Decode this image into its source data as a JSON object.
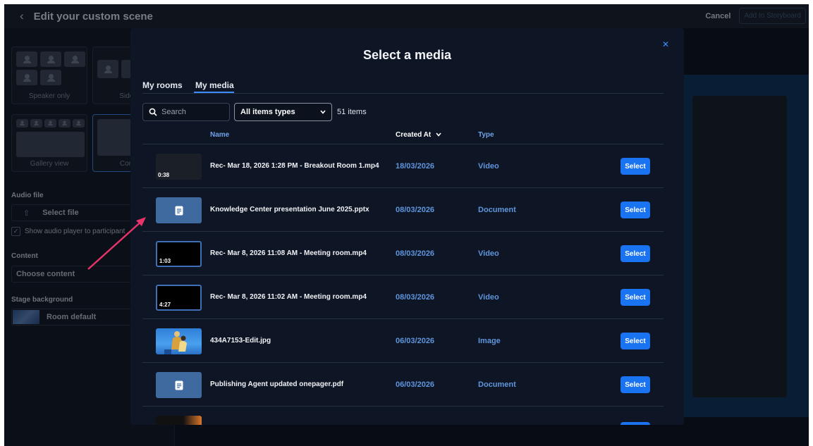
{
  "app": {
    "title": "Edit your custom scene",
    "cancel_label": "Cancel",
    "storyboard_label": "Add to Storyboard"
  },
  "left_panel": {
    "layouts": [
      {
        "label": "Speaker only"
      },
      {
        "label": "Side by"
      },
      {
        "label": "Gallery view"
      },
      {
        "label": "Conten"
      }
    ],
    "audio_file_label": "Audio file",
    "select_file_label": "Select file",
    "show_player_label": "Show audio player to participant",
    "content_label": "Content",
    "choose_content_label": "Choose content",
    "stage_background_label": "Stage background",
    "room_default_label": "Room default"
  },
  "modal": {
    "title": "Select a media",
    "close_icon": "close-icon",
    "tabs": [
      {
        "label": "My rooms",
        "active": false
      },
      {
        "label": "My media",
        "active": true
      }
    ],
    "search_placeholder": "Search",
    "filter_selected": "All items types",
    "items_count": "51 items",
    "columns": {
      "name": "Name",
      "created_at": "Created At",
      "type": "Type"
    },
    "select_label": "Select",
    "rows": [
      {
        "thumb": "video",
        "duration": "0:38",
        "name": "Rec- Mar 18, 2026 1:28 PM - Breakout Room 1.mp4",
        "date": "18/03/2026",
        "type": "Video"
      },
      {
        "thumb": "document",
        "duration": "",
        "name": "Knowledge Center presentation June 2025.pptx",
        "date": "08/03/2026",
        "type": "Document"
      },
      {
        "thumb": "video-frame",
        "duration": "1:03",
        "name": "Rec- Mar 8, 2026 11:08 AM - Meeting room.mp4",
        "date": "08/03/2026",
        "type": "Video"
      },
      {
        "thumb": "video-frame",
        "duration": "4:27",
        "name": "Rec- Mar 8, 2026 11:02 AM - Meeting room.mp4",
        "date": "08/03/2026",
        "type": "Video"
      },
      {
        "thumb": "image",
        "duration": "",
        "name": "434A7153-Edit.jpg",
        "date": "06/03/2026",
        "type": "Image"
      },
      {
        "thumb": "document",
        "duration": "",
        "name": "Publishing Agent updated onepager.pdf",
        "date": "06/03/2026",
        "type": "Document"
      }
    ]
  },
  "colors": {
    "accent": "#1a73f0",
    "link_blue": "#5f95dd",
    "modal_bg": "#0e1524",
    "annotation_arrow": "#e8336b"
  }
}
